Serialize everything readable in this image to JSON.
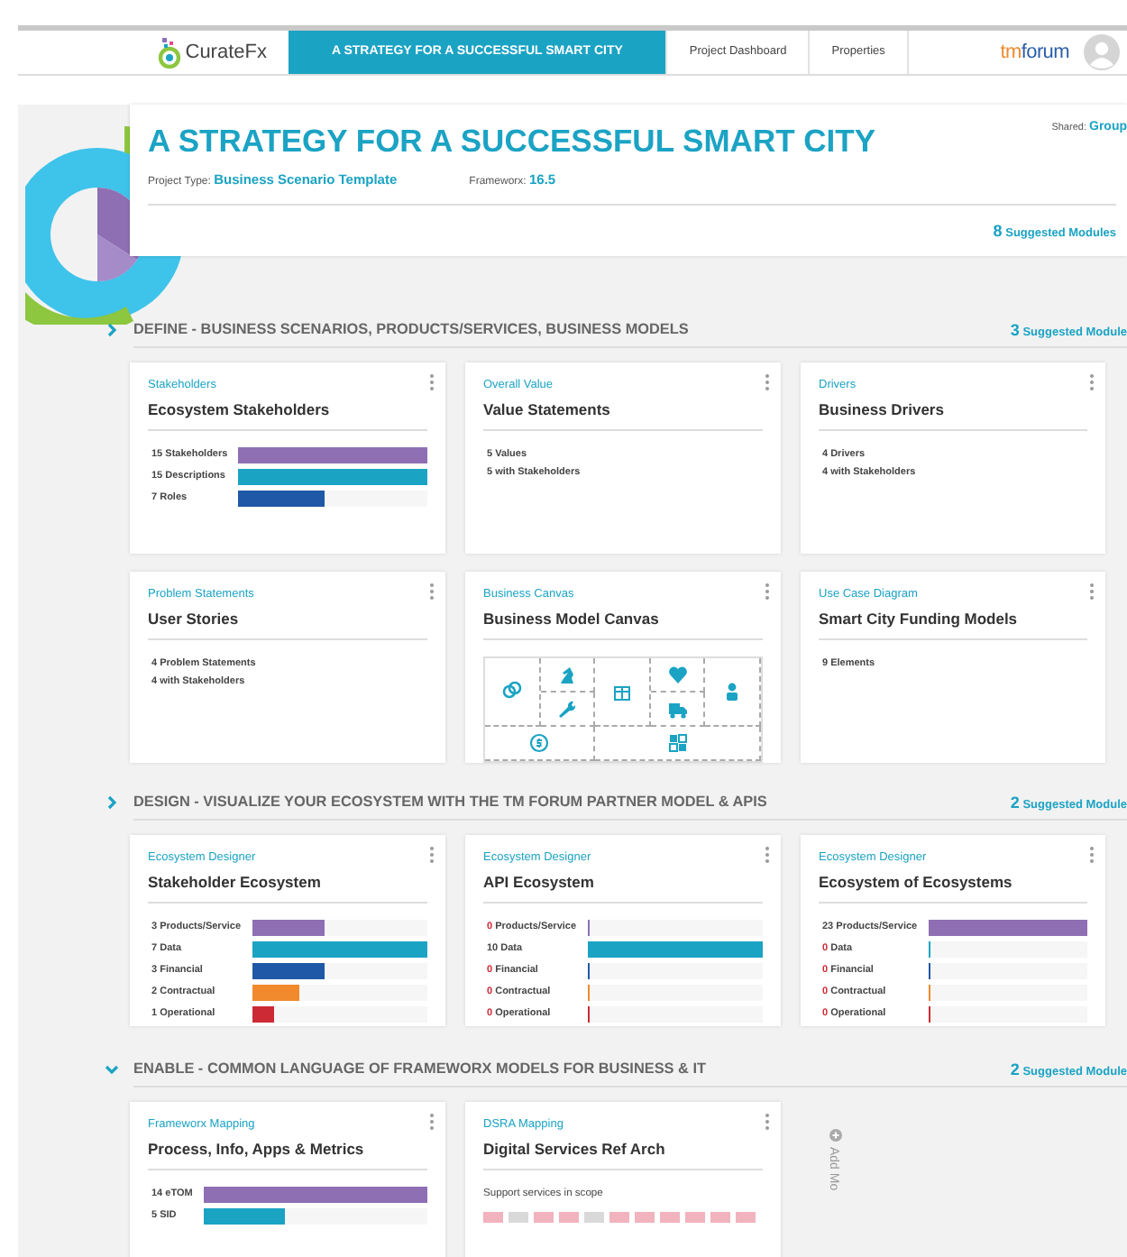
{
  "header": {
    "logo": "CurateFx",
    "partner_logo": "tmforum",
    "tabs": [
      {
        "label": "A STRATEGY FOR A SUCCESSFUL SMART CITY",
        "selected": true
      },
      {
        "label": "Project Dashboard",
        "selected": false
      },
      {
        "label": "Properties",
        "selected": false
      }
    ]
  },
  "project": {
    "title": "A STRATEGY FOR A SUCCESSFUL SMART CITY",
    "type_label": "Project Type:",
    "type_value": "Business Scenario Template",
    "framework_label": "Frameworx:",
    "framework_value": "16.5",
    "shared_label": "Shared:",
    "shared_value": "Group",
    "suggested_count": "8",
    "suggested_label": "Suggested Modules"
  },
  "sections": [
    {
      "title": "DEFINE - BUSINESS SCENARIOS, PRODUCTS/SERVICES, BUSINESS MODELS",
      "expanded": false,
      "suggested_count": "3",
      "suggested_label": "Suggested Module",
      "cards": [
        {
          "kind": "bars",
          "category": "Stakeholders",
          "title": "Ecosystem Stakeholders",
          "bars": [
            {
              "count": "15",
              "label": "Stakeholders",
              "level": 1,
              "color": "#8e6fb4"
            },
            {
              "count": "15",
              "label": "Descriptions",
              "level": 1,
              "color": "#1ba3c4"
            },
            {
              "count": "7",
              "label": "Roles",
              "level": 0.46,
              "color": "#1f58a6"
            }
          ]
        },
        {
          "kind": "stats",
          "category": "Overall Value",
          "title": "Value Statements",
          "lines": [
            "5 Values",
            "5 with Stakeholders"
          ]
        },
        {
          "kind": "stats",
          "category": "Drivers",
          "title": "Business Drivers",
          "lines": [
            "4 Drivers",
            "4 with Stakeholders"
          ]
        },
        {
          "kind": "stats",
          "category": "Problem Statements",
          "title": "User Stories",
          "lines": [
            "4 Problem Statements",
            "4 with Stakeholders"
          ]
        },
        {
          "kind": "canvas",
          "category": "Business Canvas",
          "title": "Business Model Canvas"
        },
        {
          "kind": "stats",
          "category": "Use Case Diagram",
          "title": "Smart City Funding Models",
          "lines": [
            "9 Elements"
          ]
        }
      ]
    },
    {
      "title": "DESIGN - VISUALIZE YOUR ECOSYSTEM WITH THE TM FORUM PARTNER MODEL & APIS",
      "expanded": false,
      "suggested_count": "2",
      "suggested_label": "Suggested Module",
      "cards": [
        {
          "kind": "bars",
          "category": "Ecosystem Designer",
          "title": "Stakeholder Ecosystem",
          "bars": [
            {
              "count": "3",
              "label": "Products/Service",
              "level": 0.42,
              "color": "#8e6fb4"
            },
            {
              "count": "7",
              "label": "Data",
              "level": 1,
              "color": "#1ba3c4"
            },
            {
              "count": "3",
              "label": "Financial",
              "level": 0.42,
              "color": "#1f58a6"
            },
            {
              "count": "2",
              "label": "Contractual",
              "level": 0.27,
              "color": "#f08a2c"
            },
            {
              "count": "1",
              "label": "Operational",
              "level": 0.13,
              "color": "#cc2b36"
            }
          ]
        },
        {
          "kind": "bars",
          "category": "Ecosystem Designer",
          "title": "API Ecosystem",
          "bars": [
            {
              "count": "0",
              "label": "Products/Service",
              "level": 0,
              "color": "#8e6fb4"
            },
            {
              "count": "10",
              "label": "Data",
              "level": 1,
              "color": "#1ba3c4"
            },
            {
              "count": "0",
              "label": "Financial",
              "level": 0,
              "color": "#1f58a6"
            },
            {
              "count": "0",
              "label": "Contractual",
              "level": 0,
              "color": "#f08a2c"
            },
            {
              "count": "0",
              "label": "Operational",
              "level": 0,
              "color": "#cc2b36"
            }
          ]
        },
        {
          "kind": "bars",
          "category": "Ecosystem Designer",
          "title": "Ecosystem of Ecosystems",
          "bars": [
            {
              "count": "23",
              "label": "Products/Service",
              "level": 1,
              "color": "#8e6fb4"
            },
            {
              "count": "0",
              "label": "Data",
              "level": 0,
              "color": "#1ba3c4"
            },
            {
              "count": "0",
              "label": "Financial",
              "level": 0,
              "color": "#1f58a6"
            },
            {
              "count": "0",
              "label": "Contractual",
              "level": 0,
              "color": "#f08a2c"
            },
            {
              "count": "0",
              "label": "Operational",
              "level": 0,
              "color": "#cc2b36"
            }
          ]
        }
      ]
    },
    {
      "title": "ENABLE - COMMON LANGUAGE OF FRAMEWORX MODELS FOR BUSINESS & IT",
      "expanded": true,
      "suggested_count": "2",
      "suggested_label": "Suggested Module",
      "add_label": "Add Mo",
      "cards": [
        {
          "kind": "bars",
          "category": "Frameworx Mapping",
          "title": "Process, Info, Apps & Metrics",
          "bars": [
            {
              "count": "14",
              "label": "eTOM",
              "level": 1,
              "color": "#8e6fb4"
            },
            {
              "count": "5",
              "label": "SID",
              "level": 0.36,
              "color": "#1ba3c4"
            }
          ]
        },
        {
          "kind": "services",
          "category": "DSRA Mapping",
          "title": "Digital Services Ref Arch",
          "caption": "Support services in scope"
        }
      ]
    }
  ]
}
